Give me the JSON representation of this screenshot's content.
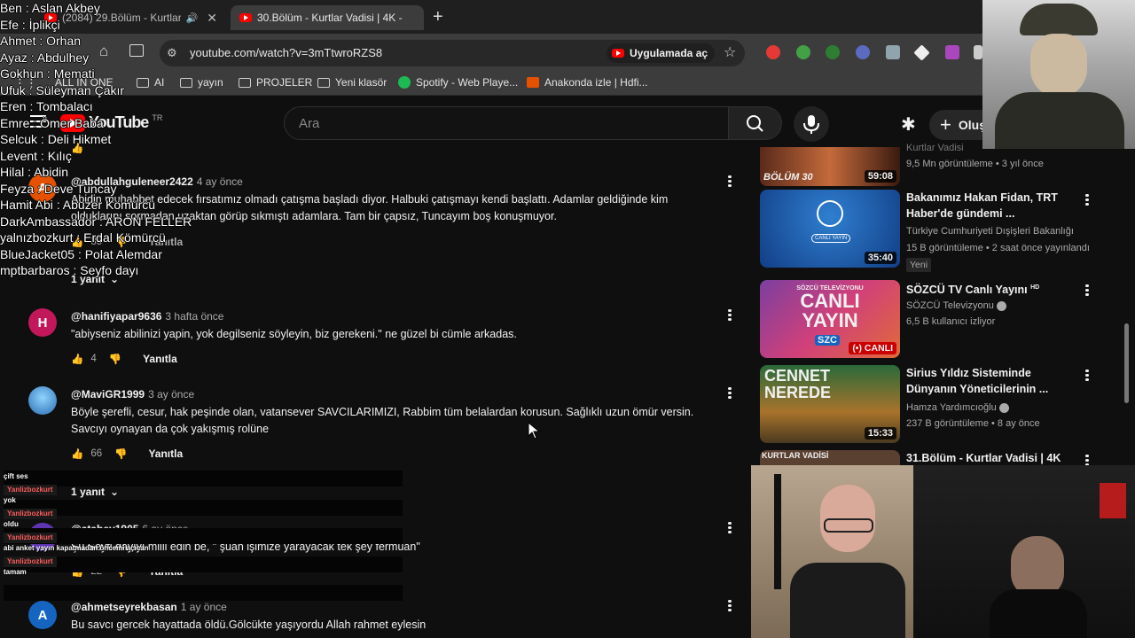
{
  "browser": {
    "tabs": [
      {
        "label": "(2084) 29.Bölüm - Kurtlar V",
        "audio": true
      },
      {
        "label": "30.Bölüm - Kurtlar Vadisi | 4K -"
      }
    ],
    "url": "youtube.com/watch?v=3mTtwroRZS8",
    "open_in_app": "Uygulamada aç",
    "bookmarks": [
      "ALL IN ONE",
      "AI",
      "yayın",
      "PROJELER",
      "Yeni klasör",
      "Spotify - Web Playe...",
      "Anakonda izle | Hdfi..."
    ]
  },
  "youtube": {
    "logo": "YouTube",
    "region": "TR",
    "search_placeholder": "Ara",
    "create_label": "Oluş"
  },
  "comments": [
    {
      "author": "@abdullahguleneer2422",
      "time": "4 ay önce",
      "line1": "Abidin muhabbet edecek fırsatımız olmadı çatışma başladı diyor. Halbuki çatışmayı kendi başlattı. Adamlar geldiğinde kim",
      "line2": "olduklarını sormadan uzaktan görüp sıkmıştı adamlara. Tam bir çapsız, Tuncayım boş konuşmuyor.",
      "likes": "35",
      "reply": "Yanıtla",
      "replies": "1 yanıt"
    },
    {
      "author": "@hanifiyapar9636",
      "time": "3 hafta önce",
      "avatar": "H",
      "avatar_color": "#c2185b",
      "line1": "\"abiyseniz abilinizi yapin, yok degilseniz söyleyin, biz gerekeni.\" ne güzel bi cümle arkadas.",
      "likes": "4",
      "reply": "Yanıtla"
    },
    {
      "author": "@MaviGR1999",
      "time": "3 ay önce",
      "line1": "Böyle şerefli,  cesur,  hak peşinde olan,  vatansever SAVCILARIMIZI,  Rabbim tüm belalardan korusun. Sağlıklı uzun  ömür versin.",
      "line2": "Savcıyı oynayan da çok yakışmış rolüne",
      "likes": "66",
      "reply": "Yanıtla",
      "replies": "1 yanıt"
    },
    {
      "author": "@atabey1905",
      "time": "6 ay önce",
      "avatar": "A",
      "line1": "Şu Seyfi dayıyı miiii edin be, \" şuan işimize yarayacak tek şey fermuan\"",
      "likes": "22",
      "reply": "Yanıtla"
    },
    {
      "author": "@ahmetseyrekbasan",
      "time": "1 ay önce",
      "avatar": "A",
      "avatar_color": "#1565c0",
      "line1": "Bu savcı gercek hayattada öldü.Gölcükte yaşıyordu Allah rahmet eylesin"
    }
  ],
  "sidebar": [
    {
      "thumb_text": "BÖLÜM 30",
      "duration": "59:08",
      "channel": "Kurtlar Vadisi",
      "meta": "9,5 Mn görüntüleme • 3 yıl önce"
    },
    {
      "title": "Bakanımız Hakan Fidan, TRT Haber'de gündemi ...",
      "channel": "Türkiye Cumhuriyeti Dışişleri Bakanlığı",
      "meta": "15 B görüntüleme • 2 saat önce yayınlandı",
      "badge": "Yeni",
      "duration": "35:40",
      "thumb_text": "CANLI YAYIN"
    },
    {
      "title": "SÖZCÜ TV Canlı Yayını",
      "hd": "HD",
      "channel": "SÖZCÜ Televizyonu",
      "meta": "6,5 B kullanıcı izliyor",
      "thumb_line1": "SÖZCÜ TELEVİZYONU",
      "thumb_line2": "CANLI",
      "thumb_line3": "YAYIN",
      "thumb_logo": "SZC",
      "live": "CANLI"
    },
    {
      "title": "Sirius Yıldız Sisteminde Dünyanın Yöneticilerinin ...",
      "channel": "Hamza Yardımcıoğlu",
      "meta": "237 B görüntüleme • 8 ay önce",
      "duration": "15:33",
      "thumb_line1": "CENNET",
      "thumb_line2": "NEREDE"
    },
    {
      "title": "31.Bölüm - Kurtlar Vadisi | 4K",
      "thumb_text": "KURTLAR VADİSİ"
    }
  ],
  "overlay_names": [
    "Ben : Aslan Akbey",
    "Efe : İplikçi",
    "Ahmet : Orhan",
    "Ayaz : Abdulhey",
    "Gokhun : Memati",
    "Ufuk : Süleyman Çakır",
    "Eren : Tombalacı",
    "Emre : Ömer Baba",
    "Selcuk : Deli Hikmet",
    "Levent : Kılıç",
    "Hilal : Abidin",
    "Feyza : Deve Tuncay",
    "Hamit Abi : Abuzer Kömürcü",
    "DarkAmbassador : ARON FELLER",
    "yalnızbozkurt : Erdal Kömürcü",
    "BlueJacket05 : Polat Alemdar",
    "mptbarbaros : Seyfo dayı"
  ],
  "chat": [
    {
      "msg": "çift ses"
    },
    {
      "user": "Yanlizbozkurt",
      "msg": "yok"
    },
    {
      "user": "Yanlizbozkurt",
      "msg": "oldu"
    },
    {
      "user": "Yanlizbozkurt",
      "msg": "abi anket yayın kapatmadan öncemi açıcan"
    },
    {
      "user": "Yanlizbozkurt",
      "msg": "tamam"
    }
  ]
}
